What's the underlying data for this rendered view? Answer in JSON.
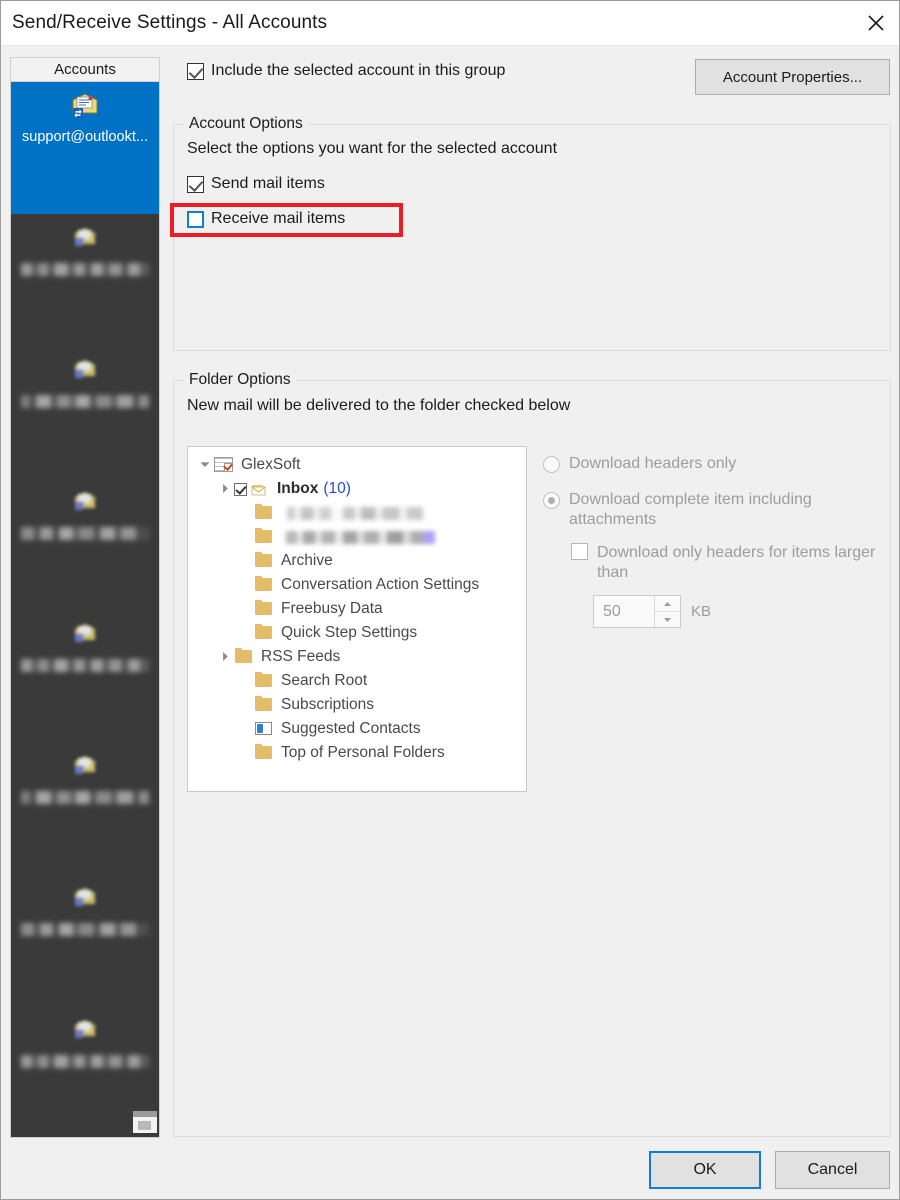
{
  "window": {
    "title": "Send/Receive Settings - All Accounts",
    "close_icon": "close-icon"
  },
  "sidebar": {
    "header": "Accounts",
    "items": [
      {
        "label": "support@outlookt...",
        "selected": true,
        "redacted": false
      },
      {
        "label": "",
        "selected": false,
        "redacted": true
      },
      {
        "label": "",
        "selected": false,
        "redacted": true
      },
      {
        "label": "",
        "selected": false,
        "redacted": true
      },
      {
        "label": "",
        "selected": false,
        "redacted": true
      },
      {
        "label": "",
        "selected": false,
        "redacted": true
      },
      {
        "label": "",
        "selected": false,
        "redacted": true
      },
      {
        "label": "",
        "selected": false,
        "redacted": true
      }
    ]
  },
  "toolbar": {
    "account_properties_label": "Account Properties..."
  },
  "include_account": {
    "label": "Include the selected account in this group",
    "checked": true
  },
  "account_options": {
    "title": "Account Options",
    "description": "Select the options you want for the selected account",
    "send_mail": {
      "label": "Send mail items",
      "checked": true
    },
    "receive_mail": {
      "label": "Receive mail items",
      "checked": false,
      "focused": true,
      "annotated": true
    }
  },
  "folder_options": {
    "title": "Folder Options",
    "description": "New mail will be delivered to the folder checked below",
    "tree": [
      {
        "label": "GlexSoft",
        "indent": 0,
        "icon": "data-file-icon",
        "expander": "expanded",
        "checkbox": "none",
        "bold": false,
        "count": null,
        "redacted": false
      },
      {
        "label": "Inbox",
        "indent": 1,
        "icon": "inbox-icon",
        "expander": "collapsed",
        "checkbox": "checked",
        "bold": true,
        "count": "(10)",
        "redacted": false
      },
      {
        "label": "",
        "indent": 2,
        "icon": "folder-icon",
        "expander": "none",
        "checkbox": "none",
        "bold": false,
        "count": null,
        "redacted": true
      },
      {
        "label": "",
        "indent": 2,
        "icon": "folder-icon",
        "expander": "none",
        "checkbox": "none",
        "bold": false,
        "count": null,
        "redacted": true
      },
      {
        "label": "Archive",
        "indent": 2,
        "icon": "folder-icon",
        "expander": "none",
        "checkbox": "none",
        "bold": false,
        "count": null,
        "redacted": false
      },
      {
        "label": "Conversation Action Settings",
        "indent": 2,
        "icon": "folder-icon",
        "expander": "none",
        "checkbox": "none",
        "bold": false,
        "count": null,
        "redacted": false
      },
      {
        "label": "Freebusy Data",
        "indent": 2,
        "icon": "folder-icon",
        "expander": "none",
        "checkbox": "none",
        "bold": false,
        "count": null,
        "redacted": false
      },
      {
        "label": "Quick Step Settings",
        "indent": 2,
        "icon": "folder-icon",
        "expander": "none",
        "checkbox": "none",
        "bold": false,
        "count": null,
        "redacted": false
      },
      {
        "label": "RSS Feeds",
        "indent": 2,
        "icon": "folder-icon",
        "expander": "collapsed",
        "checkbox": "none",
        "bold": false,
        "count": null,
        "redacted": false
      },
      {
        "label": "Search Root",
        "indent": 2,
        "icon": "folder-icon",
        "expander": "none",
        "checkbox": "none",
        "bold": false,
        "count": null,
        "redacted": false
      },
      {
        "label": "Subscriptions",
        "indent": 2,
        "icon": "folder-icon",
        "expander": "none",
        "checkbox": "none",
        "bold": false,
        "count": null,
        "redacted": false
      },
      {
        "label": "Suggested Contacts",
        "indent": 2,
        "icon": "contacts-icon",
        "expander": "none",
        "checkbox": "none",
        "bold": false,
        "count": null,
        "redacted": false
      },
      {
        "label": "Top of Personal Folders",
        "indent": 2,
        "icon": "folder-icon",
        "expander": "none",
        "checkbox": "none",
        "bold": false,
        "count": null,
        "redacted": false
      }
    ],
    "download": {
      "headers_only": {
        "label": "Download headers only",
        "selected": false,
        "disabled": true
      },
      "complete_item": {
        "label": "Download complete item including attachments",
        "selected": true,
        "disabled": true
      },
      "only_headers_larger": {
        "label": "Download only headers for items larger than",
        "checked": false,
        "disabled": true
      },
      "size_value": "50",
      "size_unit": "KB"
    }
  },
  "footer": {
    "ok_label": "OK",
    "cancel_label": "Cancel"
  },
  "colors": {
    "accent_blue": "#0072c6",
    "focus_blue": "#0f7fd4",
    "annotation_red": "#ee1c25",
    "link_blue": "#2c49d4",
    "dialog_bg": "#f0f0f0",
    "sidebar_bg": "#3a3a3a"
  }
}
